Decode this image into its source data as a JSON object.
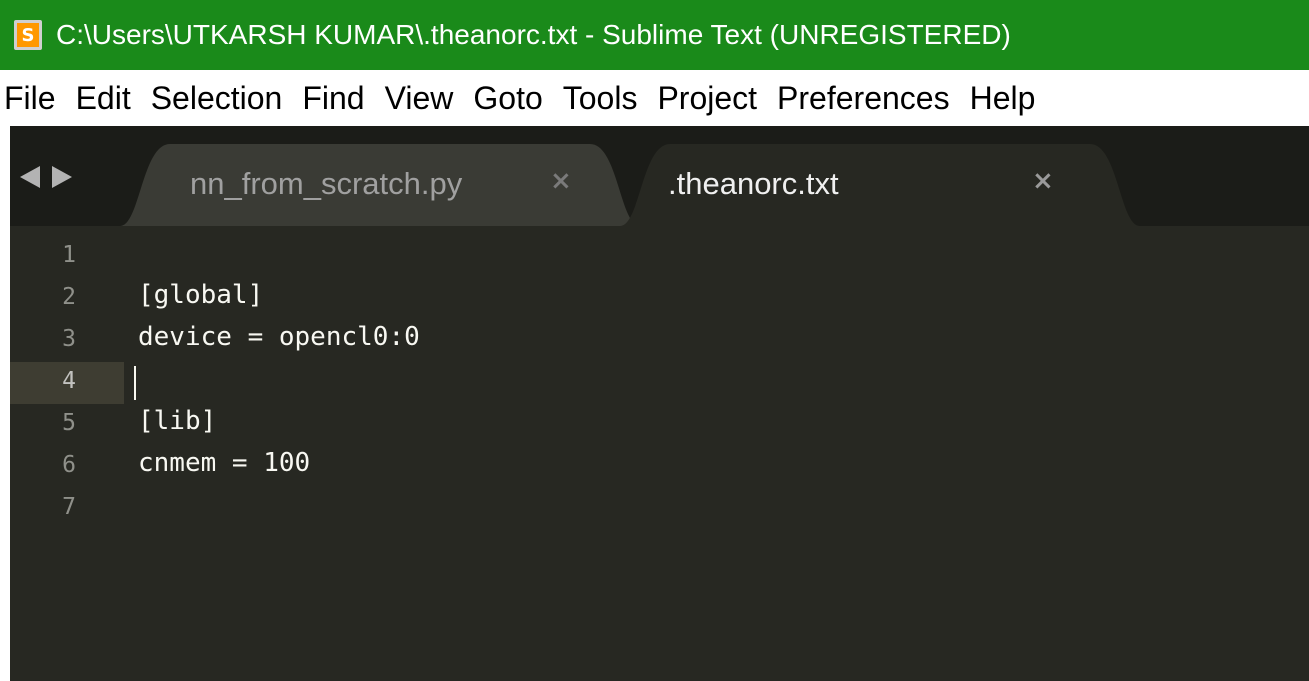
{
  "window": {
    "title": "C:\\Users\\UTKARSH KUMAR\\.theanorc.txt - Sublime Text (UNREGISTERED)",
    "icon_letter": "S"
  },
  "menu": [
    "File",
    "Edit",
    "Selection",
    "Find",
    "View",
    "Goto",
    "Tools",
    "Project",
    "Preferences",
    "Help"
  ],
  "tabs": [
    {
      "label": "nn_from_scratch.py",
      "close": "×",
      "active": false
    },
    {
      "label": ".theanorc.txt",
      "close": "×",
      "active": true
    }
  ],
  "editor": {
    "current_line": 4,
    "lines": [
      {
        "num": "1",
        "text": ""
      },
      {
        "num": "2",
        "text": "[global]"
      },
      {
        "num": "3",
        "text": "device = opencl0:0"
      },
      {
        "num": "4",
        "text": ""
      },
      {
        "num": "5",
        "text": "[lib]"
      },
      {
        "num": "6",
        "text": "cnmem = 100"
      },
      {
        "num": "7",
        "text": ""
      }
    ]
  },
  "colors": {
    "titlebar": "#1a8a1a",
    "editor_bg": "#272822",
    "tabstrip_bg": "#1b1c18",
    "active_tab": "#272822",
    "inactive_tab": "#3a3b35"
  }
}
